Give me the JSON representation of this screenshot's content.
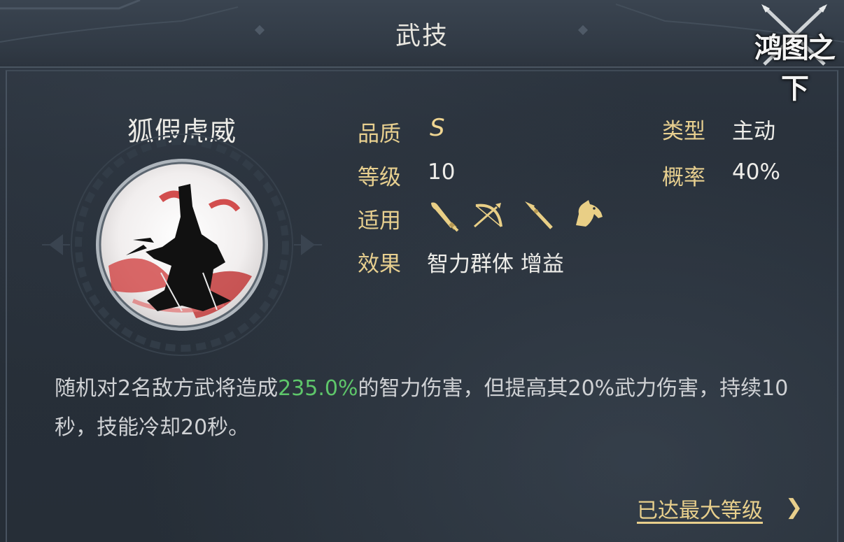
{
  "header": {
    "title": "武技"
  },
  "logo": {
    "text": "鸿图之下"
  },
  "skill": {
    "name": "狐假虎威",
    "icon": "fox-silhouette-skill-icon",
    "attributes": {
      "quality_label": "品质",
      "quality_value": "S",
      "type_label": "类型",
      "type_value": "主动",
      "level_label": "等级",
      "level_value": "10",
      "chance_label": "概率",
      "chance_value": "40%",
      "applicable_label": "适用",
      "applicable_icons": [
        "saber-icon",
        "bow-icon",
        "spear-icon",
        "horse-icon"
      ],
      "effect_label": "效果",
      "effect_value": "智力群体 增益"
    },
    "description": {
      "part1": "随机对2名敌方武将造成",
      "highlight": "235.0%",
      "part2": "的智力伤害，但提高其20%武力伤害，持续10秒，技能冷却20秒。"
    }
  },
  "footer": {
    "max_level_text": "已达最大等级",
    "chevron": "❯"
  },
  "colors": {
    "background": "#262e37",
    "label_gold": "#e7cf8f",
    "highlight_green": "#5ec66a",
    "text_white": "#eeede9"
  }
}
